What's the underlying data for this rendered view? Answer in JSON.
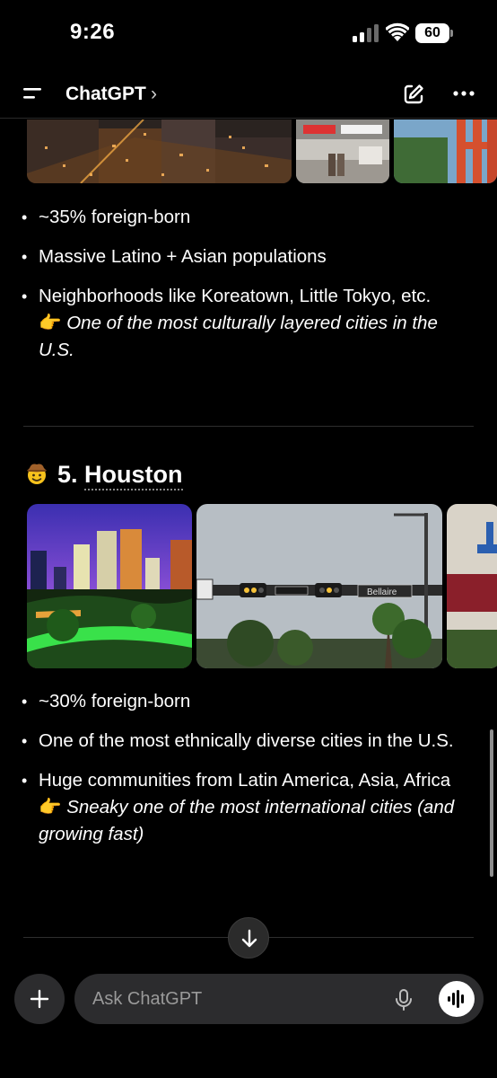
{
  "status_bar": {
    "time": "9:26",
    "battery": "60"
  },
  "header": {
    "title": "ChatGPT",
    "chevron": "›"
  },
  "section_la": {
    "bullets": [
      "~35% foreign-born",
      "Massive Latino + Asian populations",
      "Neighborhoods like Koreatown, Little Tokyo, etc."
    ],
    "callout_emoji": "👉",
    "callout": "One of the most culturally layered cities in the U.S."
  },
  "section_houston": {
    "emoji": "cowboy-face-icon",
    "number": "5.",
    "city": "Houston",
    "sign_text": "Bellaire",
    "bullets": [
      "~30% foreign-born",
      "One of the most ethnically diverse cities in the U.S.",
      "Huge communities from Latin America, Asia, Africa"
    ],
    "callout_emoji": "👉",
    "callout": "Sneaky one of the most international cities (and growing fast)"
  },
  "composer": {
    "placeholder": "Ask ChatGPT"
  },
  "icons": {
    "menu": "menu-icon",
    "edit": "new-chat-icon",
    "more": "more-icon",
    "scroll": "arrow-down-icon",
    "plus": "plus-icon",
    "mic": "mic-icon",
    "voice": "voice-mode-icon"
  }
}
